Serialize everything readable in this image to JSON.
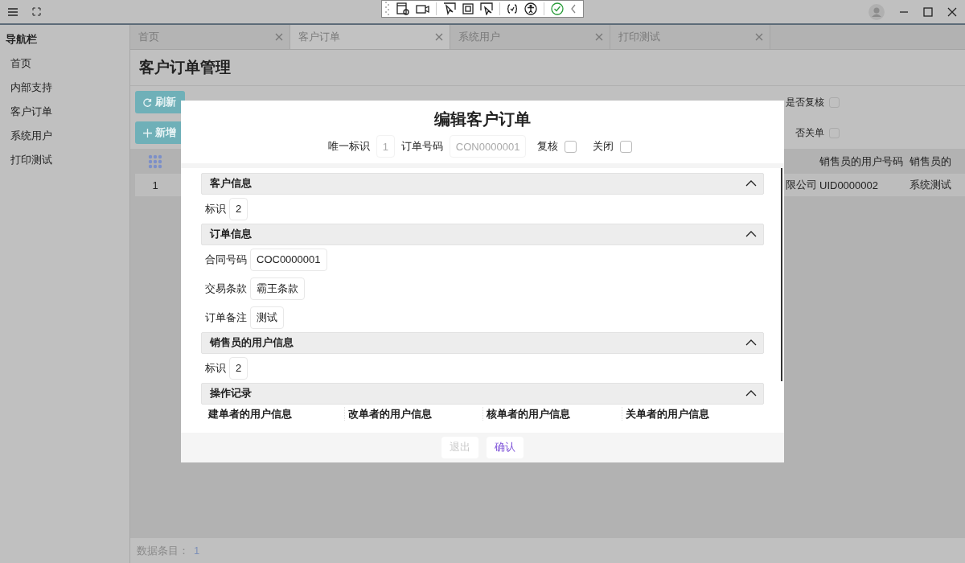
{
  "sidebar": {
    "title": "导航栏",
    "items": [
      {
        "label": "首页"
      },
      {
        "label": "内部支持"
      },
      {
        "label": "客户订单"
      },
      {
        "label": "系统用户"
      },
      {
        "label": "打印测试"
      }
    ]
  },
  "tabs": [
    {
      "label": "首页",
      "selected": false
    },
    {
      "label": "客户订单",
      "selected": true
    },
    {
      "label": "系统用户",
      "selected": false
    },
    {
      "label": "打印测试",
      "selected": false
    }
  ],
  "page_title": "客户订单管理",
  "toolbar": {
    "buttons": [
      {
        "label": "刷新",
        "kind": "refresh"
      },
      {
        "label": "新增",
        "kind": "add"
      }
    ],
    "filters": [
      {
        "label": "是否复核",
        "checked": false
      },
      {
        "label": "否关单",
        "checked": false
      }
    ]
  },
  "table": {
    "columns": [
      "",
      "销售员的用户号码",
      "销售员的"
    ],
    "rows": [
      {
        "index": "1",
        "cells": [
          "限公司",
          "UID0000002",
          "系统测试"
        ]
      }
    ]
  },
  "status_bar": {
    "label": "数据条目：",
    "count": "1"
  },
  "dialog": {
    "title": "编辑客户订单",
    "header_fields": [
      {
        "kind": "text",
        "label": "唯一标识",
        "value": "1",
        "disabled": true
      },
      {
        "kind": "text",
        "label": "订单号码",
        "value": "CON0000001",
        "disabled": true
      },
      {
        "kind": "checkbox",
        "label": "复核",
        "checked": false
      },
      {
        "kind": "checkbox",
        "label": "关闭",
        "checked": false
      }
    ],
    "sections": [
      {
        "title": "客户信息",
        "expanded": true,
        "fields": [
          {
            "label": "标识",
            "value": "2"
          }
        ]
      },
      {
        "title": "订单信息",
        "expanded": true,
        "fields": [
          {
            "label": "合同号码",
            "value": "COC0000001"
          },
          {
            "label": "交易条款",
            "value": "霸王条款"
          },
          {
            "label": "订单备注",
            "value": "测试"
          }
        ]
      },
      {
        "title": "销售员的用户信息",
        "expanded": true,
        "fields": [
          {
            "label": "标识",
            "value": "2"
          }
        ]
      },
      {
        "title": "操作记录",
        "expanded": true,
        "columns": [
          "建单者的用户信息",
          "改单者的用户信息",
          "核单者的用户信息",
          "关单者的用户信息"
        ]
      }
    ],
    "buttons": [
      {
        "label": "退出",
        "disabled": true
      },
      {
        "label": "确认",
        "disabled": false
      }
    ]
  }
}
